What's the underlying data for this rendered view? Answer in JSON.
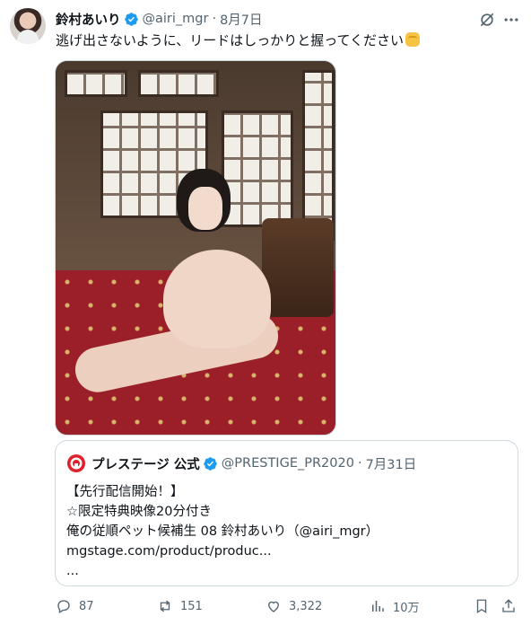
{
  "tweet": {
    "display_name": "鈴村あいり",
    "handle": "@airi_mgr",
    "separator": "·",
    "date": "8月7日",
    "text": "逃げ出さないように、リードはしっかりと握ってください"
  },
  "quote": {
    "display_name": "プレステージ 公式",
    "handle": "@PRESTIGE_PR2020",
    "separator": "·",
    "date": "7月31日",
    "lines": [
      "【先行配信開始！】",
      "☆限定特典映像20分付き",
      "俺の従順ペット候補生 08 鈴村あいり（@airi_mgr）",
      "mgstage.com/product/produc...",
      "..."
    ]
  },
  "actions": {
    "replies": "87",
    "reposts": "151",
    "likes": "3,322",
    "views": "10万"
  },
  "colors": {
    "verified": "#1d9bf0",
    "secondary_text": "#536471",
    "logo_red": "#e0202a"
  },
  "icons": [
    "grok-icon",
    "more-icon",
    "verified-icon",
    "reply-icon",
    "repost-icon",
    "like-icon",
    "views-icon",
    "bookmark-icon",
    "share-icon"
  ]
}
